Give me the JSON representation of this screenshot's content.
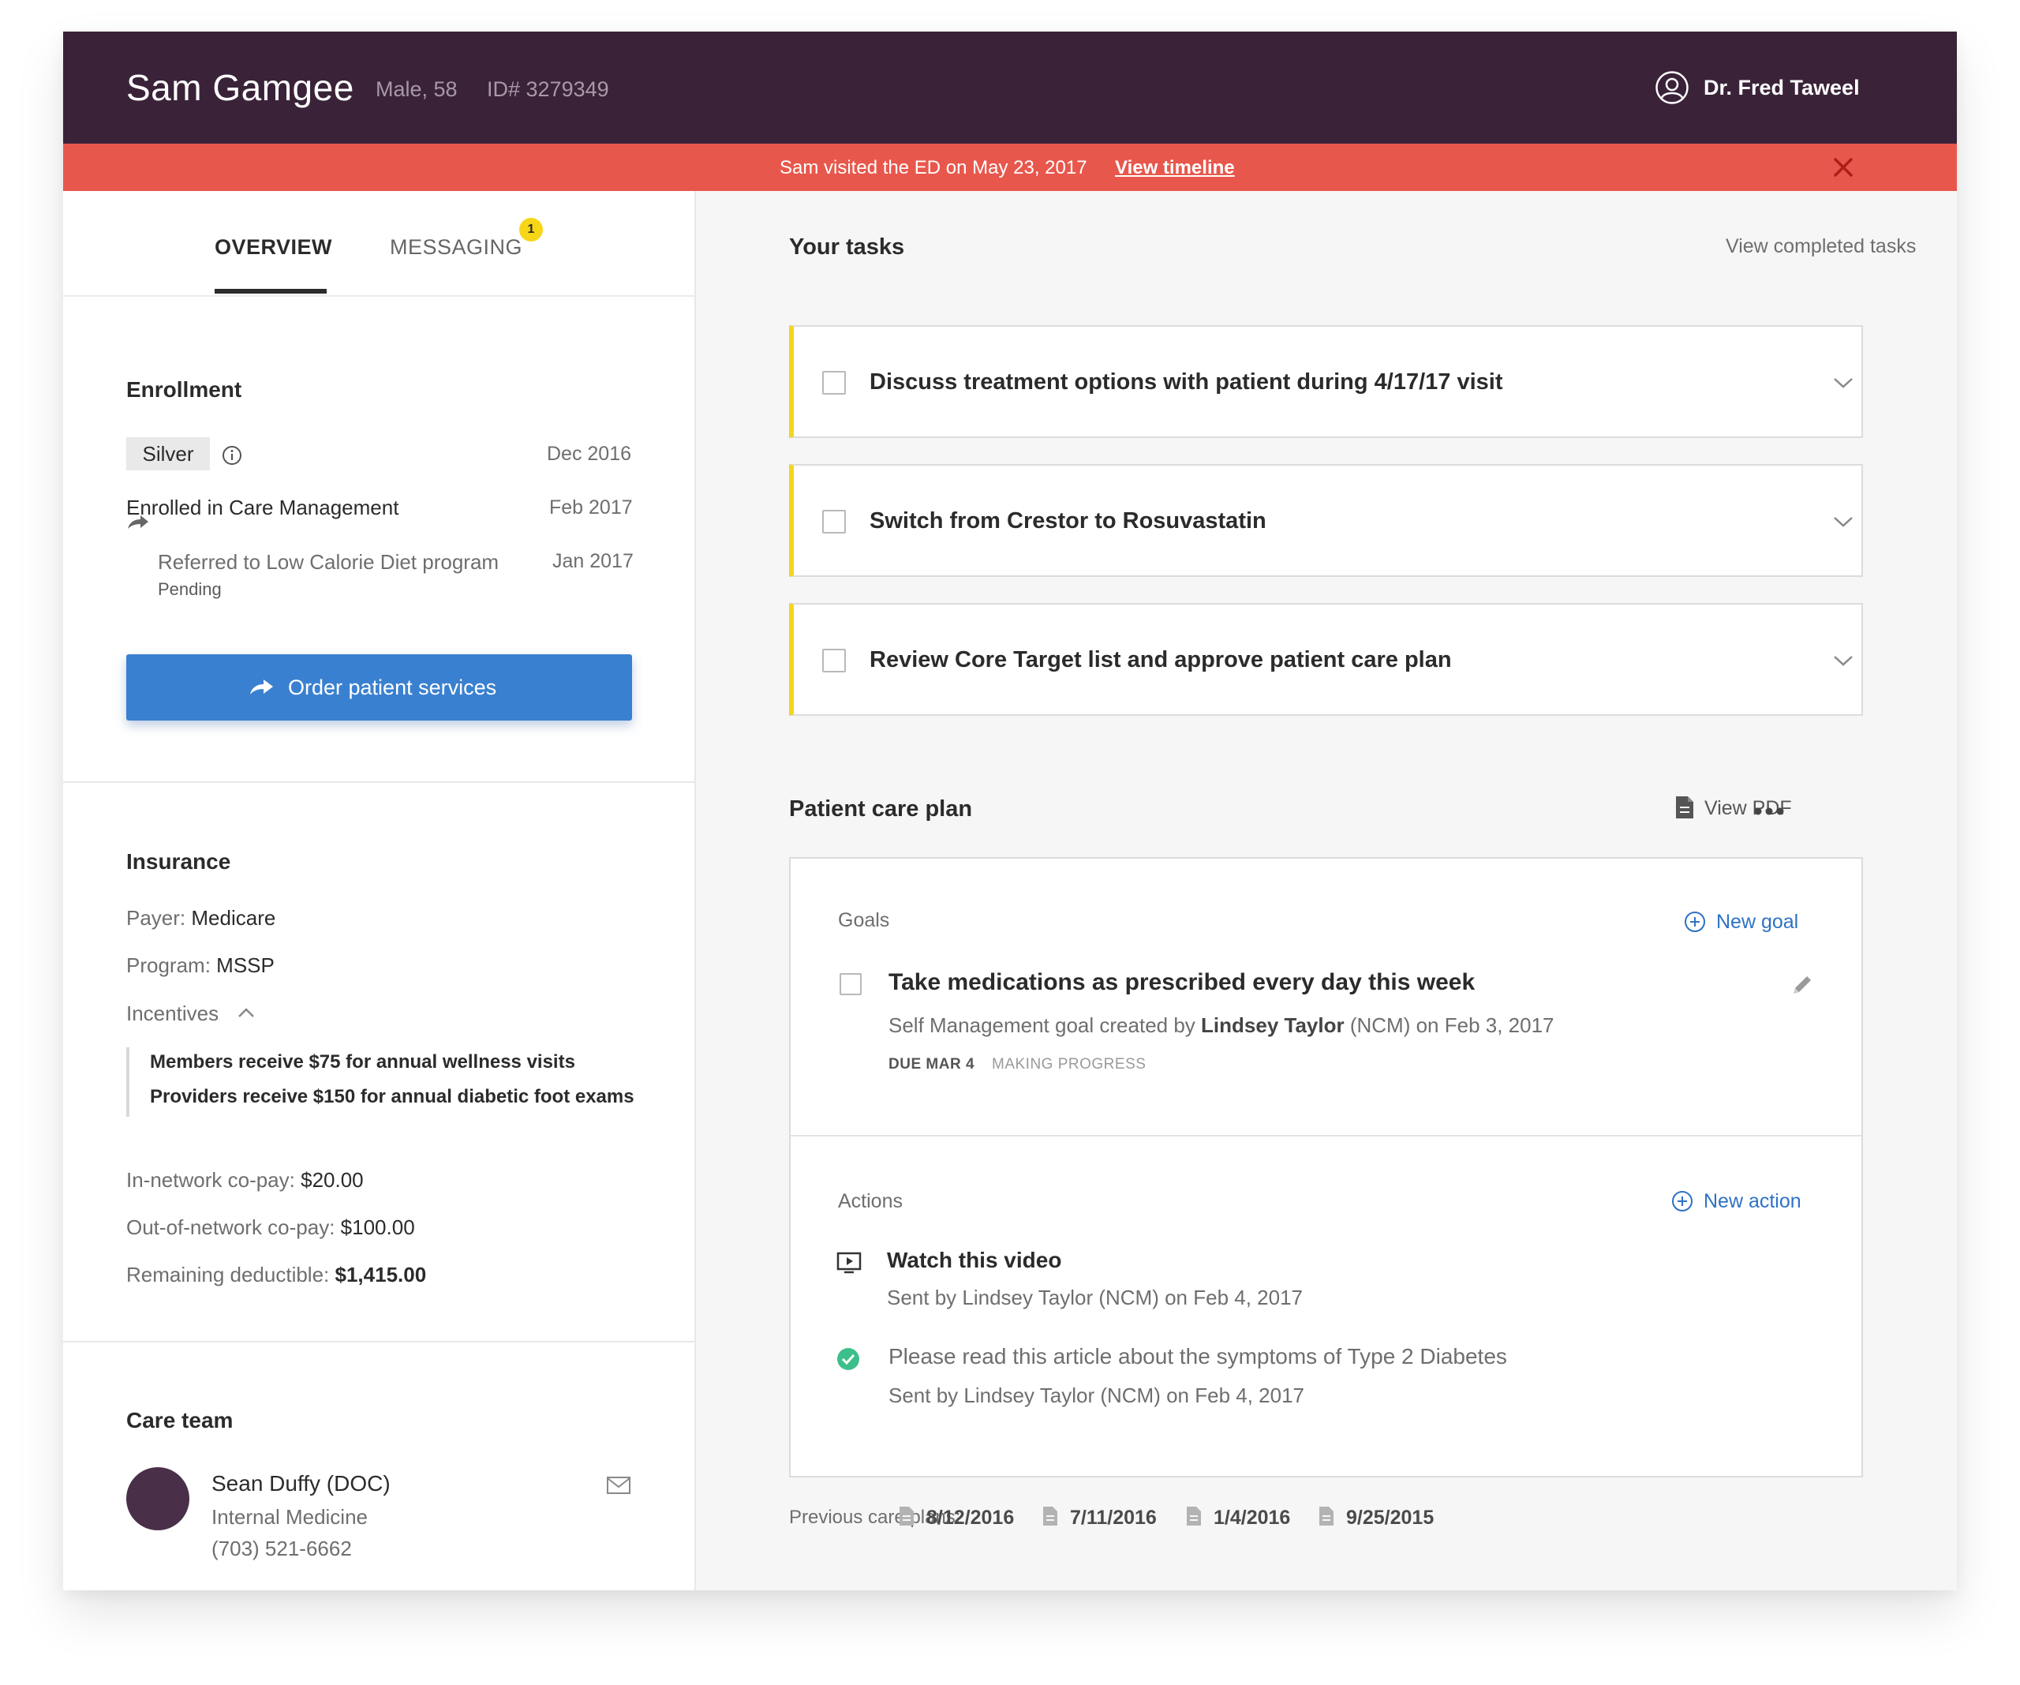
{
  "header": {
    "patient_name": "Sam Gamgee",
    "patient_sex_age": "Male, 58",
    "patient_id": "ID# 3279349",
    "user_name": "Dr. Fred Taweel",
    "user_icon": "user-circle-icon"
  },
  "alert": {
    "text": "Sam visited the ED on May 23, 2017",
    "link": "View timeline",
    "close_icon": "close-icon"
  },
  "tabs": {
    "overview": "OVERVIEW",
    "messaging": "MESSAGING",
    "messaging_badge": "1"
  },
  "enrollment": {
    "title": "Enrollment",
    "tier": "Silver",
    "tier_date": "Dec 2016",
    "care_mgmt": "Enrolled in Care Management",
    "care_mgmt_date": "Feb 2017",
    "referral": "Referred to Low Calorie Diet program",
    "referral_date": "Jan 2017",
    "referral_status": "Pending",
    "order_button": "Order patient services"
  },
  "insurance": {
    "title": "Insurance",
    "payer_label": "Payer:",
    "payer_value": "Medicare",
    "program_label": "Program:",
    "program_value": "MSSP",
    "incentives_label": "Incentives",
    "incentives": [
      "Members receive $75 for annual wellness visits",
      "Providers receive $150 for annual diabetic foot exams"
    ],
    "in_network_label": "In-network co-pay:",
    "in_network_value": "$20.00",
    "out_network_label": "Out-of-network co-pay:",
    "out_network_value": "$100.00",
    "deductible_label": "Remaining deductible:",
    "deductible_value": "$1,415.00"
  },
  "care_team": {
    "title": "Care team",
    "name": "Sean Duffy (DOC)",
    "role": "Internal Medicine",
    "phone": "(703) 521-6662"
  },
  "tasks": {
    "title": "Your tasks",
    "view_completed": "View completed tasks",
    "items": [
      {
        "label": "Discuss treatment options with patient during 4/17/17 visit"
      },
      {
        "label": "Switch from Crestor to Rosuvastatin"
      },
      {
        "label": "Review Core Target list and approve patient care plan"
      }
    ]
  },
  "care_plan": {
    "title": "Patient care plan",
    "view_pdf": "View PDF",
    "goals_label": "Goals",
    "new_goal": "New goal",
    "goal_title": "Take medications as prescribed every day this week",
    "goal_meta_prefix": "Self Management goal created by",
    "goal_meta_author": "Lindsey Taylor",
    "goal_meta_suffix": "(NCM) on Feb 3, 2017",
    "goal_due": "DUE MAR 4",
    "goal_status": "MAKING PROGRESS",
    "actions_label": "Actions",
    "new_action": "New action",
    "action1_title": "Watch this video",
    "action1_meta": "Sent by Lindsey Taylor (NCM) on Feb 4, 2017",
    "action2_title": "Please read this article about the symptoms of Type 2 Diabetes",
    "action2_meta": "Sent by Lindsey Taylor (NCM) on Feb 4, 2017"
  },
  "previous_plans": {
    "label": "Previous care plans:",
    "dates": [
      "8/12/2016",
      "7/11/2016",
      "1/4/2016",
      "9/25/2015"
    ]
  },
  "colors": {
    "header_bg": "#3a2339",
    "alert_bg": "#e8574c",
    "primary_button": "#3a80d0",
    "task_accent": "#f4d51f",
    "link": "#2e72c4",
    "success": "#3dbf8c"
  }
}
